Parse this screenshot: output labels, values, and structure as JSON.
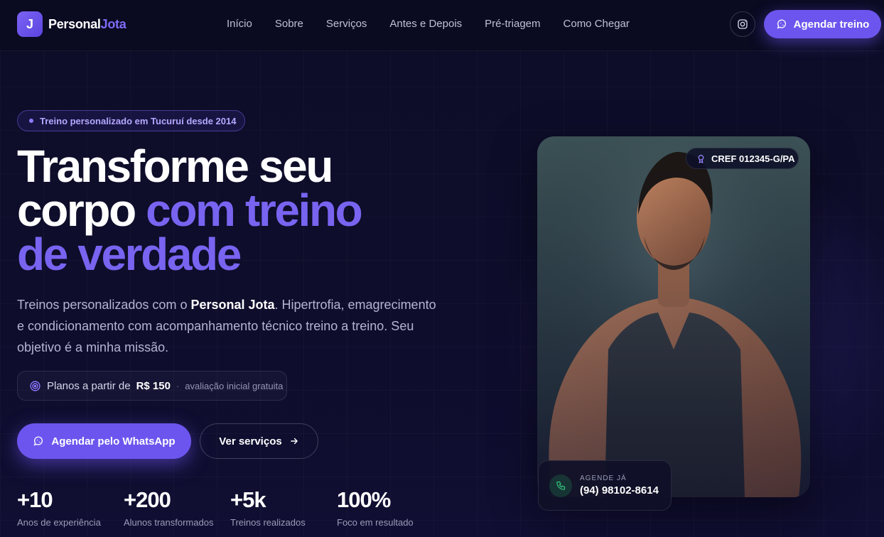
{
  "header": {
    "logo_mark": "J",
    "logo_name": "Personal",
    "logo_accent": "Jota",
    "nav": [
      "Início",
      "Sobre",
      "Serviços",
      "Antes e Depois",
      "Pré-triagem",
      "Como Chegar"
    ],
    "cta_label": "Agendar treino",
    "instagram_icon": "instagram-icon"
  },
  "hero": {
    "badge": "Treino personalizado em Tucuruí desde 2014",
    "title_line1": "Transforme seu",
    "title_line2_plain": "corpo ",
    "title_line2_highlight": "com treino",
    "title_line3": "de verdade",
    "lead_part1": "Treinos personalizados com o ",
    "lead_bold": "Personal Jota",
    "lead_part2": ". Hipertrofia, emagrecimento e condicionamento com acompanhamento técnico treino a treino. Seu objetivo é a minha missão.",
    "price_prefix": "Planos a partir de",
    "price_value": "R$ 150",
    "price_separator": "·",
    "price_note": "avaliação inicial gratuita",
    "primary_button": "Agendar pelo WhatsApp",
    "secondary_button": "Ver serviços",
    "stats": [
      {
        "value": "+10",
        "label": "Anos de experiência"
      },
      {
        "value": "+200",
        "label": "Alunos transformados"
      },
      {
        "value": "+5k",
        "label": "Treinos realizados"
      },
      {
        "value": "100%",
        "label": "Foco em resultado"
      }
    ]
  },
  "card": {
    "cref": "CREF 012345-G/PA",
    "phone_caption": "AGENDE JÁ",
    "phone_number": "(94) 98102-8614"
  },
  "colors": {
    "accent": "#6c55ee",
    "highlight_text": "#7864f0",
    "background": "#0b0b22"
  }
}
